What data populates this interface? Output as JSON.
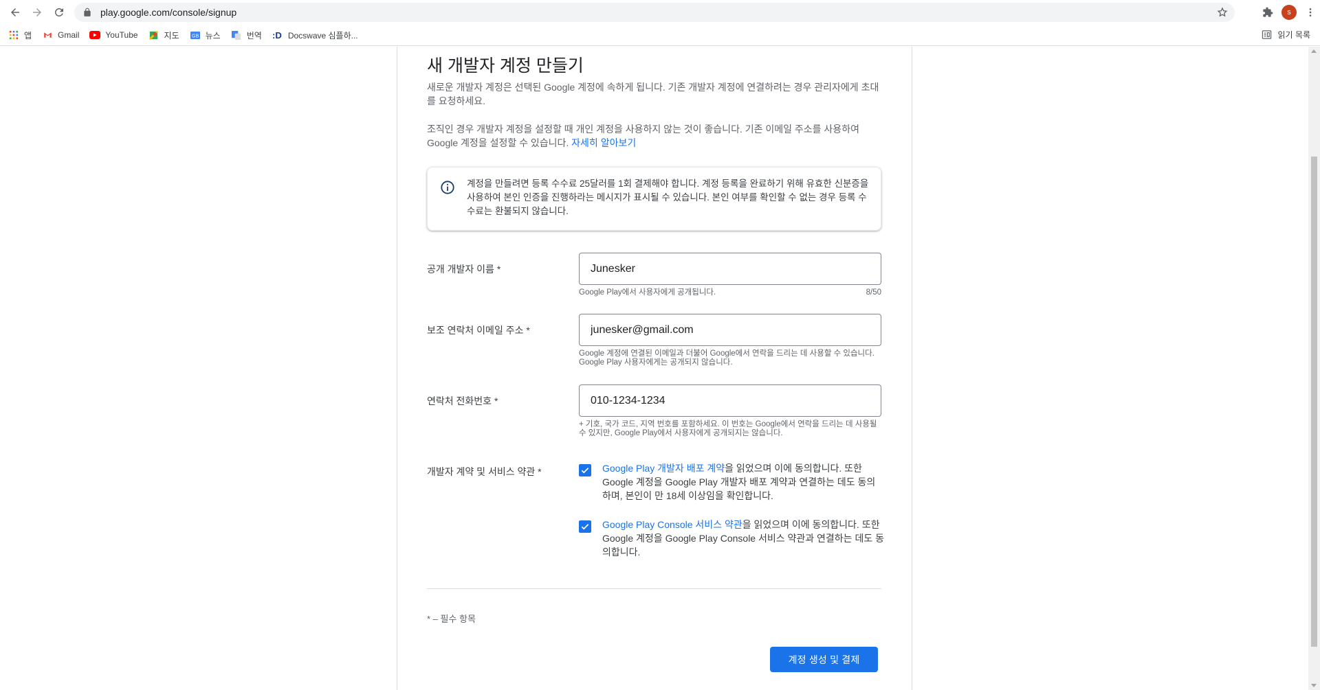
{
  "browser": {
    "url": "play.google.com/console/signup",
    "avatar_letter": "s",
    "accent_color": "#1a73e8"
  },
  "bookmarks": {
    "items": [
      {
        "label": "앱",
        "icon": "apps-grid-icon"
      },
      {
        "label": "Gmail",
        "icon": "gmail-icon"
      },
      {
        "label": "YouTube",
        "icon": "youtube-icon"
      },
      {
        "label": "지도",
        "icon": "maps-icon"
      },
      {
        "label": "뉴스",
        "icon": "news-icon"
      },
      {
        "label": "번역",
        "icon": "translate-icon"
      },
      {
        "label": "Docswave 심플하...",
        "icon": "docswave-icon"
      }
    ],
    "reading_list": "읽기 목록"
  },
  "page": {
    "title": "새 개발자 계정 만들기",
    "intro": "새로운 개발자 계정은 선택된 Google 계정에 속하게 됩니다. 기존 개발자 계정에 연결하려는 경우 관리자에게 초대를 요청하세요.",
    "org_note": "조직인 경우 개발자 계정을 설정할 때 개인 계정을 사용하지 않는 것이 좋습니다. 기존 이메일 주소를 사용하여 Google 계정을 설정할 수 있습니다.",
    "learn_more": "자세히 알아보기",
    "info_box": "계정을 만들려면 등록 수수료 25달러를 1회 결제해야 합니다. 계정 등록을 완료하기 위해 유효한 신분증을 사용하여 본인 인증을 진행하라는 메시지가 표시될 수 있습니다. 본인 여부를 확인할 수 없는 경우 등록 수수료는 환불되지 않습니다.",
    "fields": {
      "developer_name": {
        "label": "공개 개발자 이름 *",
        "value": "Junesker",
        "hint": "Google Play에서 사용자에게 공개됩니다.",
        "counter": "8/50"
      },
      "contact_email": {
        "label": "보조 연락처 이메일 주소 *",
        "value": "junesker@gmail.com",
        "hint": "Google 계정에 연결된 이메일과 더불어 Google에서 연락을 드리는 데 사용할 수 있습니다. Google Play 사용자에게는 공개되지 않습니다."
      },
      "phone": {
        "label": "연락처 전화번호 *",
        "value": "010-1234-1234",
        "hint": "+ 기호, 국가 코드, 지역 번호를 포함하세요. 이 번호는 Google에서 연락을 드리는 데 사용될 수 있지만, Google Play에서 사용자에게 공개되지는 않습니다."
      }
    },
    "terms": {
      "label": "개발자 계약 및 서비스 약관 *",
      "dda_link": "Google Play 개발자 배포 계약",
      "dda_text": "을 읽었으며 이에 동의합니다. 또한 Google 계정을 Google Play 개발자 배포 계약과 연결하는 데도 동의하며, 본인이 만 18세 이상임을 확인합니다.",
      "dda_checked": true,
      "tos_link": "Google Play Console 서비스 약관",
      "tos_text": "을 읽었으며 이에 동의합니다. 또한 Google 계정을 Google Play Console 서비스 약관과 연결하는 데도 동의합니다.",
      "tos_checked": true
    },
    "required_note": "* – 필수 항목",
    "submit_label": "계정 생성 및 결제"
  }
}
